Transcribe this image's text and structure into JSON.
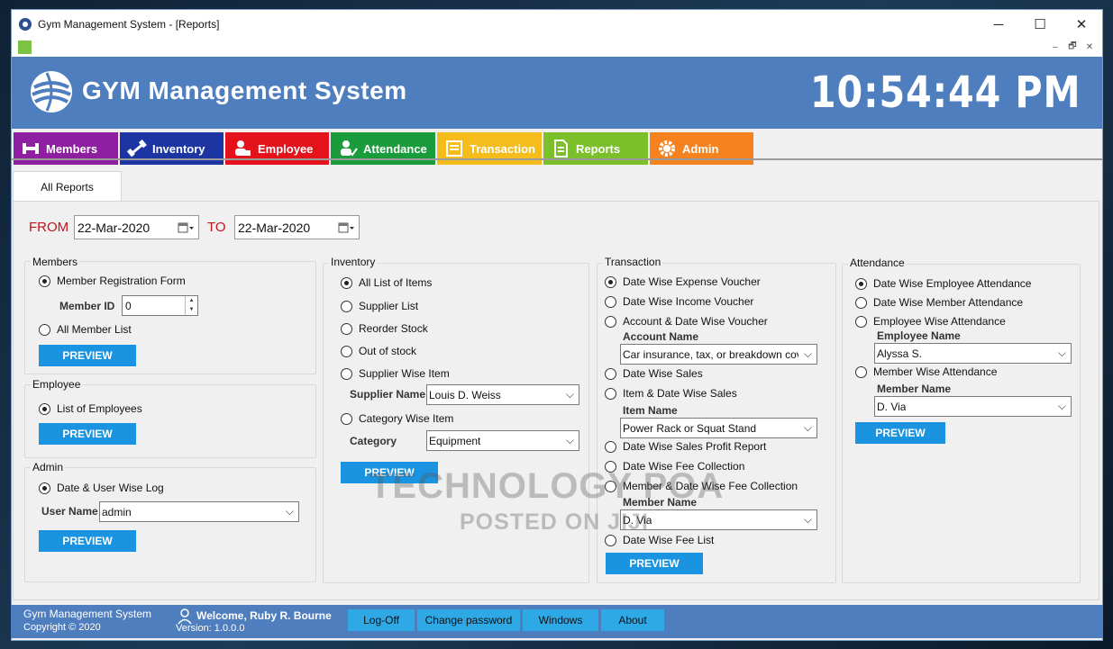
{
  "window": {
    "title": "Gym Management System - [Reports]",
    "controls": {
      "minimize": "─",
      "maximize": "☐",
      "close": "✕"
    },
    "mdi_controls": {
      "minimize": "–",
      "restore": "🗗",
      "close": "✕"
    }
  },
  "header": {
    "app_name": "GYM Management System",
    "clock": "10:54:44 PM",
    "bg_color": "#4f7ebf"
  },
  "nav": {
    "items": [
      {
        "label": "Members",
        "color": "#8e1fa1",
        "icon": "dumbbell-icon"
      },
      {
        "label": "Inventory",
        "color": "#1c35a3",
        "icon": "barbell-icon"
      },
      {
        "label": "Employee",
        "color": "#e3121b",
        "icon": "employee-icon"
      },
      {
        "label": "Attendance",
        "color": "#1a9b3c",
        "icon": "check-user-icon"
      },
      {
        "label": "Transaction",
        "color": "#f4bd1b",
        "icon": "receipt-icon"
      },
      {
        "label": "Reports",
        "color": "#7bbf2a",
        "icon": "report-icon"
      },
      {
        "label": "Admin",
        "color": "#f5821f",
        "icon": "gear-icon"
      }
    ]
  },
  "tab": {
    "label": "All Reports"
  },
  "dates": {
    "from_label": "FROM",
    "from_value": "22-Mar-2020",
    "to_label": "TO",
    "to_value": "22-Mar-2020"
  },
  "members": {
    "title": "Members",
    "opt_registration": "Member Registration Form",
    "member_id_label": "Member ID",
    "member_id_value": "0",
    "opt_all_list": "All Member List",
    "preview": "PREVIEW"
  },
  "employee": {
    "title": "Employee",
    "opt_list": "List of Employees",
    "preview": "PREVIEW"
  },
  "admin": {
    "title": "Admin",
    "opt_log": "Date & User Wise Log",
    "user_name_label": "User Name",
    "user_name_value": "admin",
    "preview": "PREVIEW"
  },
  "inventory": {
    "title": "Inventory",
    "opt_all_items": "All List of Items",
    "opt_supplier_list": "Supplier List",
    "opt_reorder": "Reorder Stock",
    "opt_out_of_stock": "Out of stock",
    "opt_supplier_item": "Supplier Wise Item",
    "supplier_label": "Supplier Name",
    "supplier_value": "Louis D. Weiss",
    "opt_category_item": "Category Wise Item",
    "category_label": "Category",
    "category_value": "Equipment",
    "preview": "PREVIEW"
  },
  "transaction": {
    "title": "Transaction",
    "opt_expense": "Date Wise Expense Voucher",
    "opt_income": "Date Wise Income Voucher",
    "opt_account": "Account & Date Wise Voucher",
    "account_label": "Account Name",
    "account_value": "Car insurance, tax, or breakdown cov",
    "opt_sales": "Date Wise Sales",
    "opt_item_sales": "Item & Date Wise Sales",
    "item_label": "Item Name",
    "item_value": "Power Rack or Squat Stand",
    "opt_profit": "Date Wise Sales Profit Report",
    "opt_fee": "Date Wise Fee Collection",
    "opt_member_fee": "Member & Date Wise Fee Collection",
    "member_label": "Member Name",
    "member_value": "D. Via",
    "opt_fee_list": "Date Wise Fee List",
    "preview": "PREVIEW"
  },
  "attendance": {
    "title": "Attendance",
    "opt_employee_date": "Date Wise Employee Attendance",
    "opt_member_date": "Date Wise Member Attendance",
    "opt_employee": "Employee Wise Attendance",
    "employee_label": "Employee Name",
    "employee_value": "Alyssa S.",
    "opt_member": "Member Wise Attendance",
    "member_label": "Member Name",
    "member_value": "D. Via",
    "preview": "PREVIEW"
  },
  "watermark": {
    "line1": "TECHNOLOGY POA",
    "line2": "POSTED ON JIJI"
  },
  "footer": {
    "app_title": "Gym Management System",
    "copyright": "Copyright  © 2020",
    "welcome": "Welcome, Ruby R. Bourne",
    "version": "Version: 1.0.0.0",
    "buttons": [
      "Log-Off",
      "Change password",
      "Windows",
      "About"
    ]
  }
}
